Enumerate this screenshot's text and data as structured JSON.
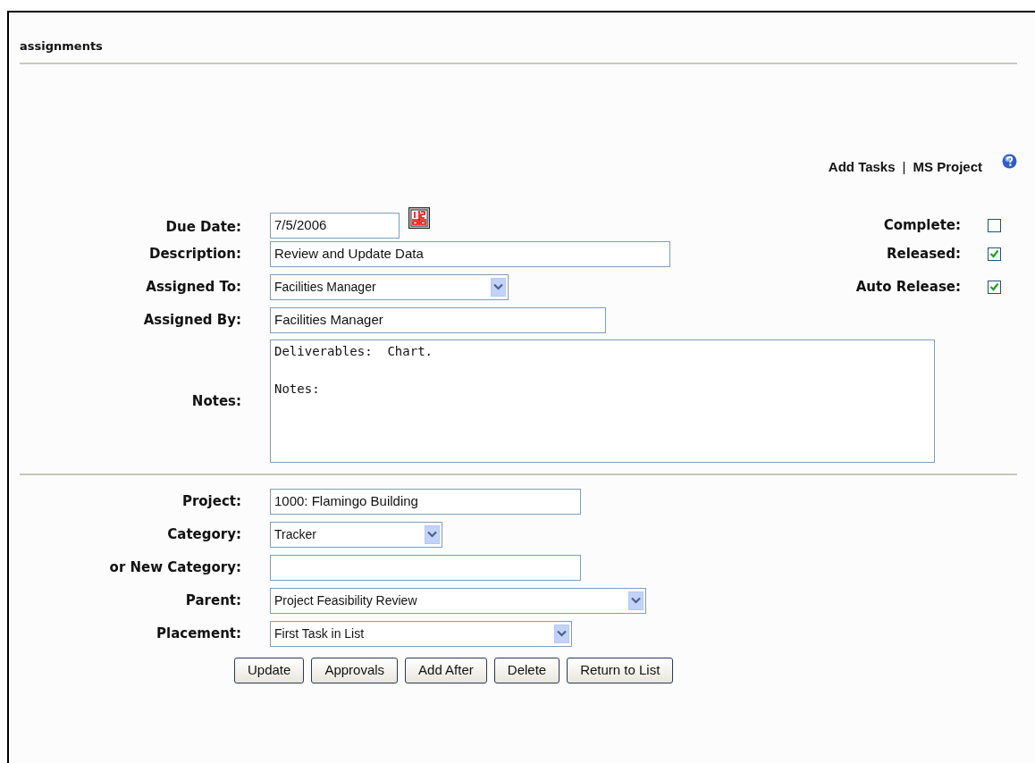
{
  "page_title": "assignments",
  "links": [
    {
      "label": "Add Tasks"
    },
    {
      "label": "MS Project"
    }
  ],
  "link_separator": "|",
  "task_fields": [
    {
      "label": "Due Date:",
      "kind": "date",
      "value": "7/5/2006"
    },
    {
      "label": "Description:",
      "kind": "text",
      "value": "Review and Update Data"
    },
    {
      "label": "Assigned To:",
      "kind": "select",
      "value": "Facilities Manager"
    },
    {
      "label": "Assigned By:",
      "kind": "text",
      "value": "Facilities Manager"
    },
    {
      "label": "Notes:",
      "kind": "textarea",
      "value": "Deliverables:  Chart.\n\nNotes:"
    }
  ],
  "flags": [
    {
      "label": "Complete:",
      "checked": false
    },
    {
      "label": "Released:",
      "checked": true
    },
    {
      "label": "Auto Release:",
      "checked": true
    }
  ],
  "project_fields": [
    {
      "label": "Project:",
      "kind": "text",
      "value": "1000: Flamingo Building"
    },
    {
      "label": "Category:",
      "kind": "select",
      "value": "Tracker"
    },
    {
      "label": "or New Category:",
      "kind": "text"
    },
    {
      "label": "Parent:",
      "kind": "select",
      "value": "Project Feasibility Review"
    },
    {
      "label": "Placement:",
      "kind": "select",
      "value": "First Task in List"
    }
  ],
  "buttons": [
    "Update",
    "Approvals",
    "Add After",
    "Delete",
    "Return to List"
  ]
}
